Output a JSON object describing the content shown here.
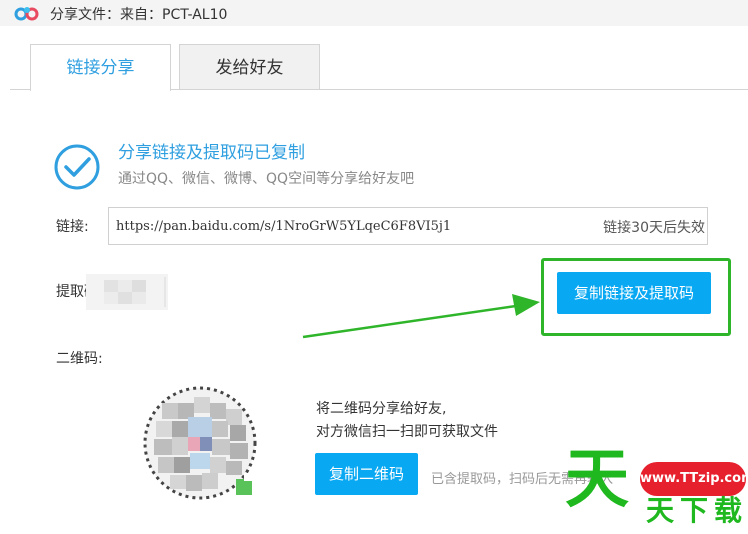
{
  "window": {
    "title": "分享文件：来自：PCT-AL10"
  },
  "tabs": [
    {
      "label": "链接分享",
      "active": true
    },
    {
      "label": "发给好友",
      "active": false
    }
  ],
  "success": {
    "title": "分享链接及提取码已复制",
    "subtitle": "通过QQ、微信、微博、QQ空间等分享给好友吧"
  },
  "link": {
    "label": "链接:",
    "url": "https://pan.baidu.com/s/1NroGrW5YLqeC6F8VI5j1",
    "expire": "链接30天后失效"
  },
  "code": {
    "label": "提取码"
  },
  "buttons": {
    "copy_link": "复制链接及提取码",
    "copy_qr": "复制二维码"
  },
  "qr": {
    "label": "二维码:",
    "desc_line1": "将二维码分享给好友,",
    "desc_line2": "对方微信扫一扫即可获取文件",
    "note": "已含提取码，扫码后无需再输入"
  },
  "watermark": {
    "url": "www.TTzip.com",
    "big_char": "天",
    "small_text": "天下载"
  },
  "colors": {
    "accent": "#09a8f2",
    "accent_text": "#2f9fe0",
    "highlight": "#2fb52a",
    "watermark_red": "#e7202e",
    "watermark_green": "#1fb81f"
  },
  "icons": [
    "baidu-netdisk-logo",
    "check-circle-icon",
    "arrow-icon"
  ]
}
